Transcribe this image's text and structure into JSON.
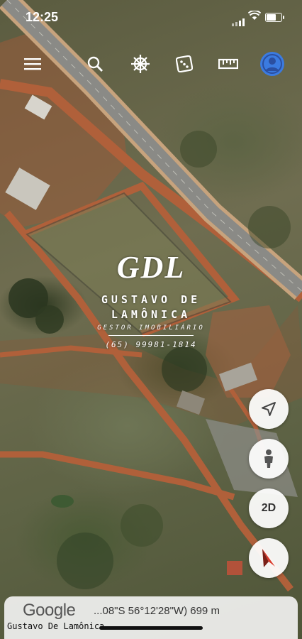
{
  "status_bar": {
    "time": "12:25"
  },
  "toolbar": {
    "items": [
      {
        "icon": "menu-icon"
      },
      {
        "icon": "search-icon"
      },
      {
        "icon": "voyager-wheel-icon"
      },
      {
        "icon": "feeling-lucky-dice-icon"
      },
      {
        "icon": "measure-ruler-icon"
      },
      {
        "icon": "profile-avatar-icon"
      }
    ]
  },
  "watermark": {
    "logo": "GDL",
    "name_line1": "GUSTAVO DE",
    "name_line2": "LAMÔNICA",
    "role": "GESTOR IMOBILIÁRIO",
    "phone": "(65) 99981-1814"
  },
  "controls": {
    "location_icon": "navigation-arrow-icon",
    "street_view_icon": "pegman-icon",
    "view_mode_label": "2D",
    "compass_icon": "compass-icon"
  },
  "footer": {
    "google_label": "Google",
    "coordinates": "...08\"S 56°12'28\"W) 699 m",
    "caption": "Gustavo De Lamônica"
  },
  "colors": {
    "road": "#8a8a86",
    "dirt_road": "#b0603a",
    "profile_accent": "#3b7be0",
    "compass_needle": "#d93a2b"
  }
}
